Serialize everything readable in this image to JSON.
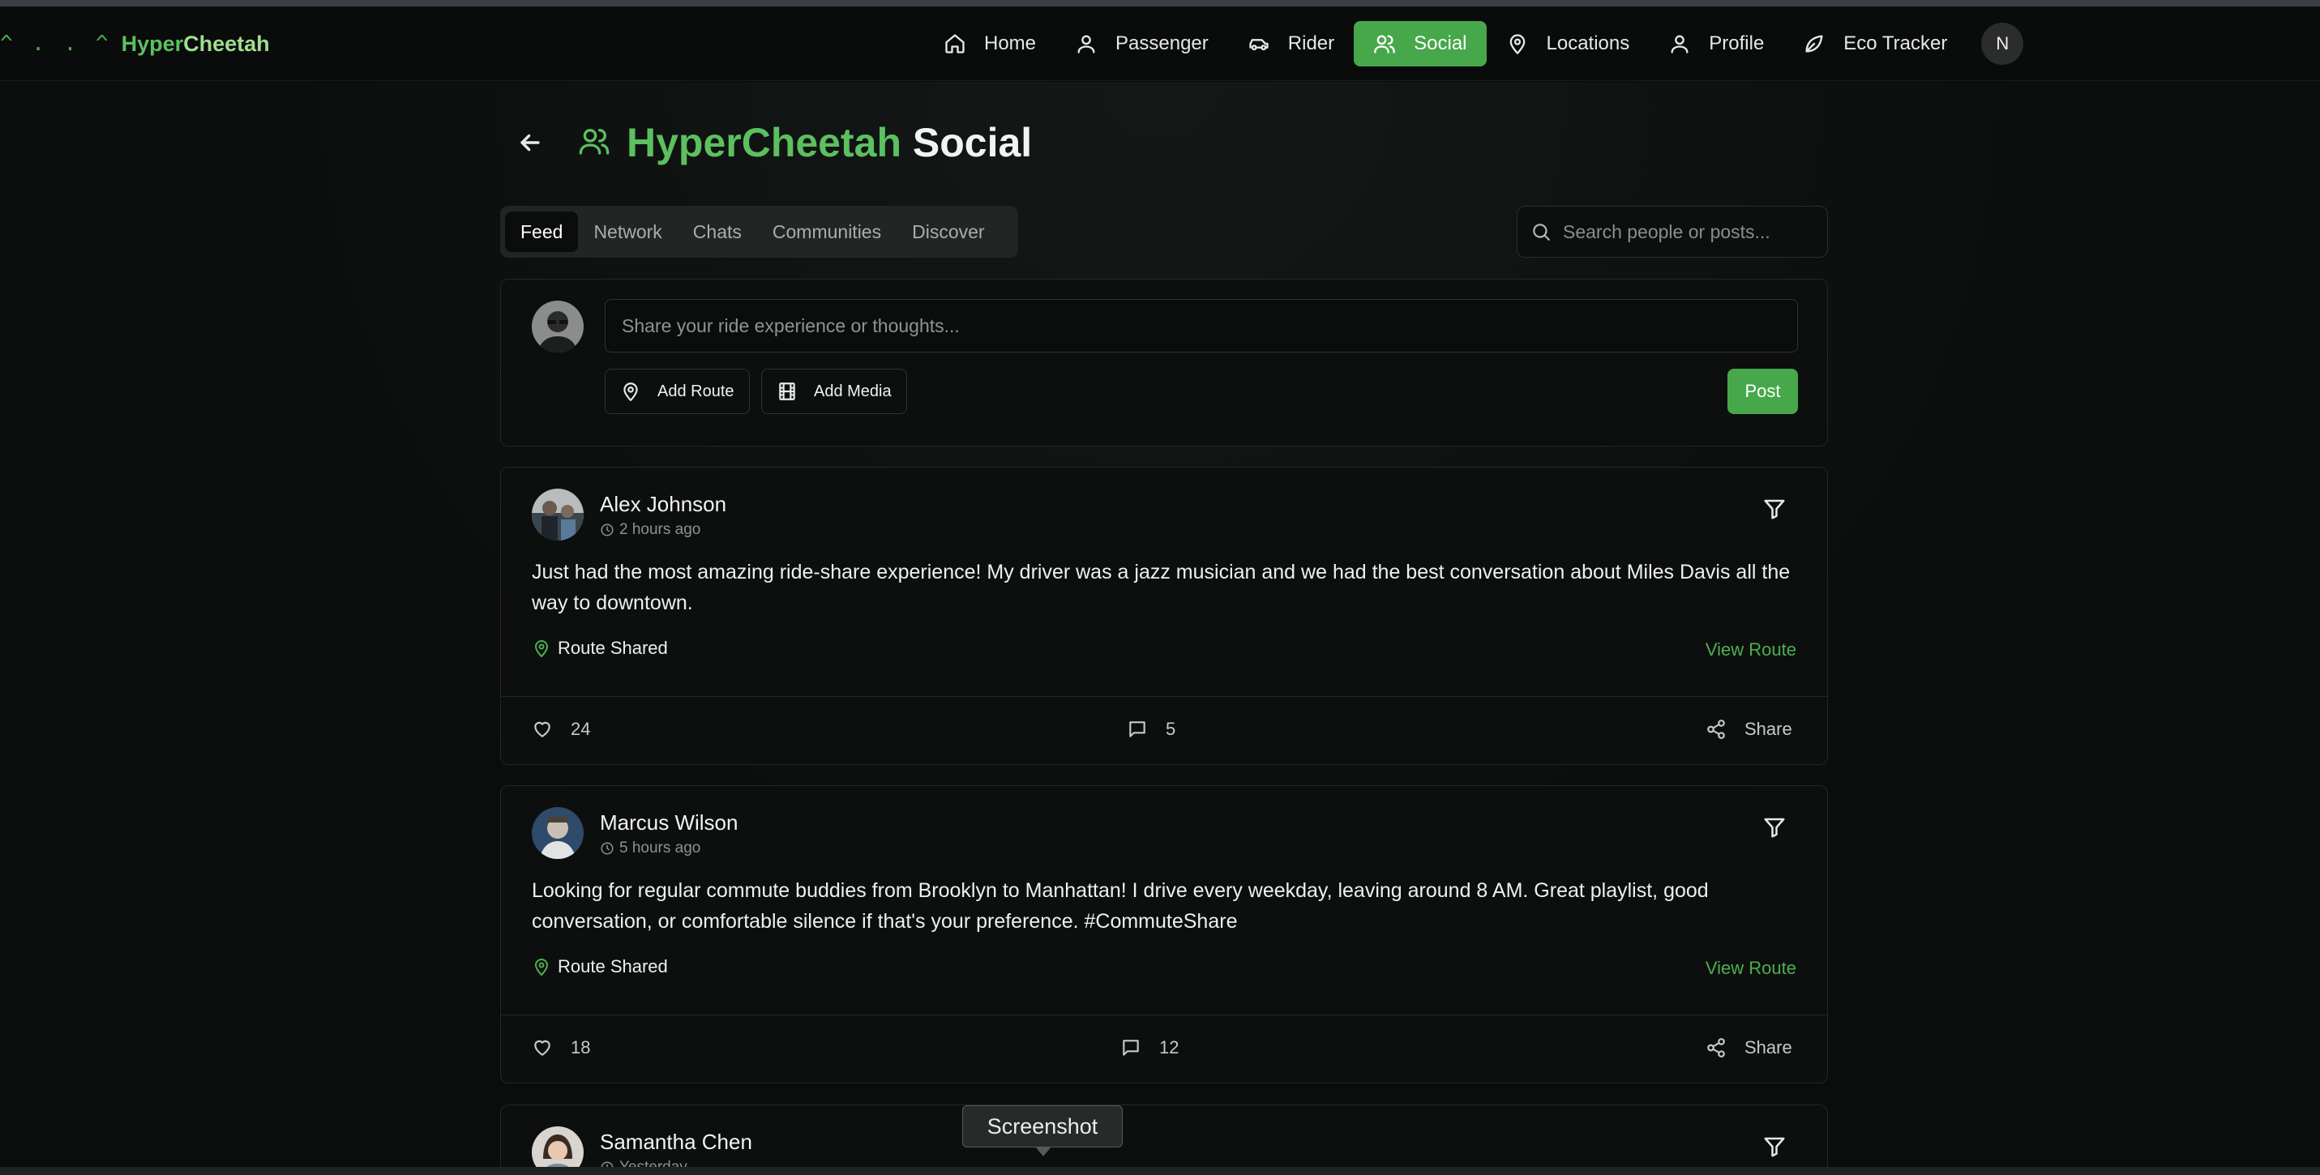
{
  "logo": {
    "mark": "^ . . ^",
    "brand_part1": "Hyper",
    "brand_part2": "Cheetah"
  },
  "nav": {
    "items": [
      {
        "label": "Home",
        "icon": "home-icon"
      },
      {
        "label": "Passenger",
        "icon": "user-icon"
      },
      {
        "label": "Rider",
        "icon": "car-icon"
      },
      {
        "label": "Social",
        "icon": "users-icon",
        "active": true
      },
      {
        "label": "Locations",
        "icon": "map-pin-icon"
      },
      {
        "label": "Profile",
        "icon": "user-icon"
      },
      {
        "label": "Eco Tracker",
        "icon": "leaf-icon"
      }
    ],
    "avatar_initial": "N"
  },
  "page": {
    "title_part1": "HyperCheetah",
    "title_part2": "Social"
  },
  "tabs": [
    {
      "label": "Feed",
      "active": true
    },
    {
      "label": "Network"
    },
    {
      "label": "Chats"
    },
    {
      "label": "Communities"
    },
    {
      "label": "Discover"
    }
  ],
  "search": {
    "placeholder": "Search people or posts...",
    "value": ""
  },
  "composer": {
    "placeholder": "Share your ride experience or thoughts...",
    "add_route": "Add Route",
    "add_media": "Add Media",
    "post": "Post"
  },
  "posts": [
    {
      "author": "Alex Johnson",
      "time": "2 hours ago",
      "body": "Just had the most amazing ride-share experience! My driver was a jazz musician and we had the best conversation about Miles Davis all the way to downtown.",
      "route_label": "Route Shared",
      "view_route": "View Route",
      "likes": "24",
      "comments": "5",
      "share": "Share"
    },
    {
      "author": "Marcus Wilson",
      "time": "5 hours ago",
      "body": "Looking for regular commute buddies from Brooklyn to Manhattan! I drive every weekday, leaving around 8 AM. Great playlist, good conversation, or comfortable silence if that's your preference. #CommuteShare",
      "route_label": "Route Shared",
      "view_route": "View Route",
      "likes": "18",
      "comments": "12",
      "share": "Share"
    },
    {
      "author": "Samantha Chen",
      "time": "Yesterday"
    }
  ],
  "tooltip": "Screenshot",
  "colors": {
    "accent": "#46a84a",
    "background": "#0b0d0c"
  }
}
